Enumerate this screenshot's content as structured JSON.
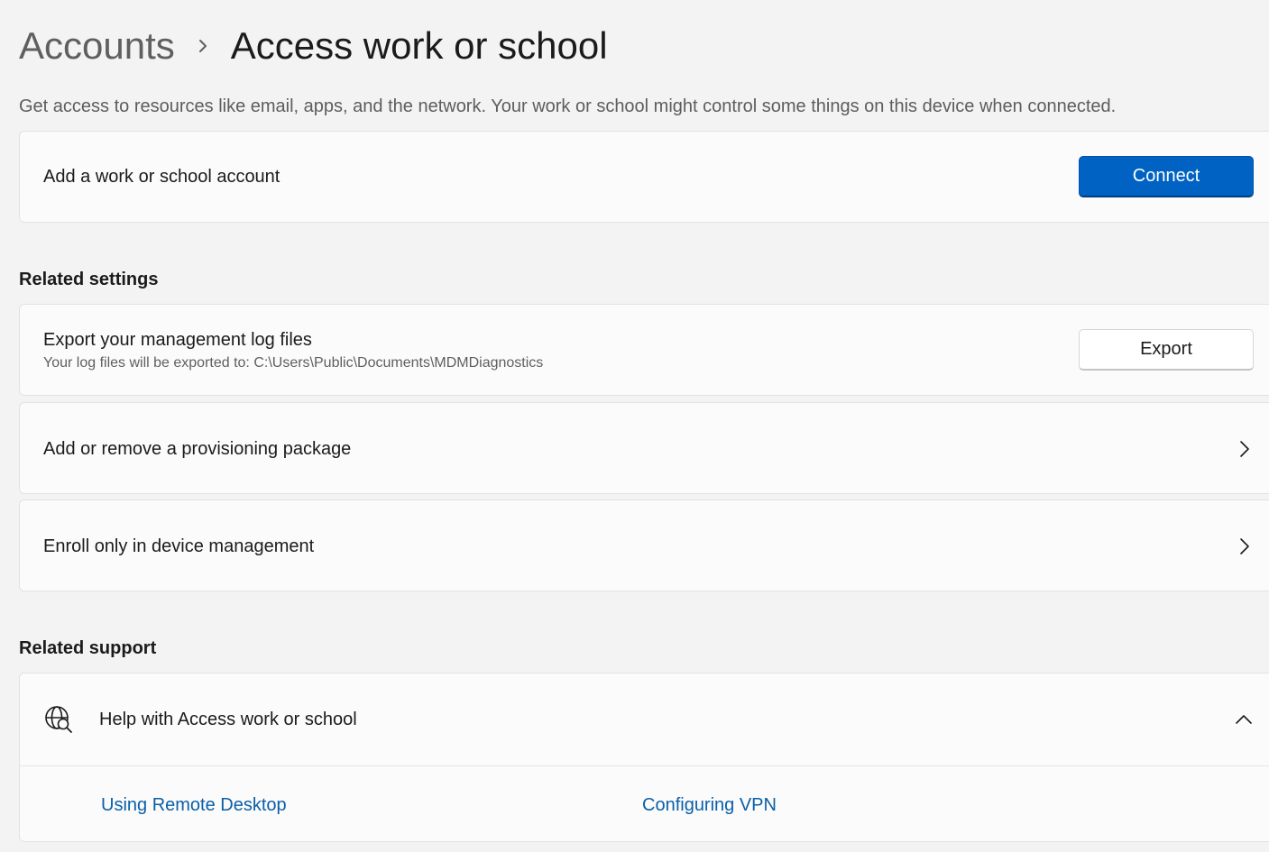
{
  "header": {
    "parent_crumb": "Accounts",
    "separator_icon": "chevron-right-icon",
    "title": "Access work or school",
    "description": "Get access to resources like email, apps, and the network. Your work or school might control some things on this device when connected."
  },
  "add_account": {
    "label": "Add a work or school account",
    "button_label": "Connect"
  },
  "related_settings": {
    "heading": "Related settings",
    "export": {
      "title": "Export your management log files",
      "subtitle": "Your log files will be exported to: C:\\Users\\Public\\Documents\\MDMDiagnostics",
      "button_label": "Export"
    },
    "provisioning": {
      "title": "Add or remove a provisioning package",
      "icon": "chevron-right-icon"
    },
    "enroll": {
      "title": "Enroll only in device management",
      "icon": "chevron-right-icon"
    }
  },
  "related_support": {
    "heading": "Related support",
    "help": {
      "icon": "globe-search-icon",
      "title": "Help with Access work or school",
      "expand_icon": "chevron-up-icon",
      "links": [
        "Using Remote Desktop",
        "Configuring VPN"
      ]
    }
  },
  "colors": {
    "accent": "#0063c4",
    "link": "#0a5fa8",
    "background": "#f3f3f3",
    "card": "#fbfbfb"
  }
}
